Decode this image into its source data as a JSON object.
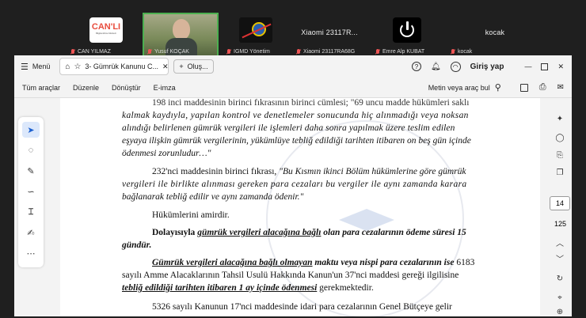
{
  "participants": [
    {
      "name": "CAN YILMAZ",
      "tile": "CAN'LI",
      "sub": "Bilgilendirme Merkezi",
      "color": "#e84c3d",
      "bg": "#fff"
    },
    {
      "name": "Yusuf KOÇAK",
      "video": true
    },
    {
      "name": "IGMD Yönetim",
      "tile": "logo"
    },
    {
      "name": "Xiaomi 23117RA68G",
      "tile": "Xiaomi 23117R..."
    },
    {
      "name": "Emre Alp KUBAT",
      "tile": "power"
    },
    {
      "name": "kocak",
      "tile": "kocak"
    }
  ],
  "tabbar": {
    "menu": "Menü",
    "active_tab": "3- Gümrük Kanunu C...",
    "new_tab": "Oluş...",
    "login": "Giriş yap"
  },
  "toolbar": {
    "items": [
      "Tüm araçlar",
      "Düzenle",
      "Dönüştür",
      "E-imza"
    ],
    "search": "Metin veya araç bul"
  },
  "rail": {
    "page": "14",
    "total": "125"
  },
  "doc": {
    "l1": "198 inci maddesinin birinci fıkrasının birinci cümlesi; \"69 uncu madde hükümleri saklı",
    "l2": "kalmak kaydıyla, yapılan kontrol ve denetlemeler sonucunda hiç alınmadığı veya noksan",
    "l3": "alındığı belirlenen gümrük vergileri ile işlemleri daha sonra yapılmak üzere teslim edilen",
    "l4": "eşyaya ilişkin gümrük vergilerinin, yükümlüye tebliğ edildiği tarihten itibaren on beş gün içinde",
    "l5": "ödenmesi zorunludur…\"",
    "l6a": "232'nci maddesinin birinci fıkrası, ",
    "l6b": "\"Bu Kısmın ikinci Bölüm hükümlerine göre gümrük",
    "l7": "vergileri ile birlikte alınması gereken para cezaları bu vergiler ile aynı zamanda karara",
    "l8": "bağlanarak tebliğ edilir ve aynı zamanda ödenir.\"",
    "l9": "Hükümlerini amirdir.",
    "l10a": "Dolayısıyla ",
    "l10b": "gümrük vergileri alacağına bağlı",
    "l10c": " olan para cezalarının ödeme süresi 15",
    "l11": "gündür.",
    "l12a": "Gümrük vergileri alacağına bağlı olmayan",
    "l12b": " maktu veya nispi para cezalarının ise",
    "l12c": " 6183",
    "l13": "sayılı Amme Alacaklarının Tahsil Usulü Hakkında Kanun'un 37'nci maddesi gereği ilgilisine",
    "l14a": "tebliğ edildiği tarihten itibaren 1 ay içinde ödenmesi",
    "l14b": " gerekmektedir.",
    "l15": "5326 sayılı Kanunun 17'nci maddesinde idari para cezalarının Genel Bütçeye gelir"
  }
}
